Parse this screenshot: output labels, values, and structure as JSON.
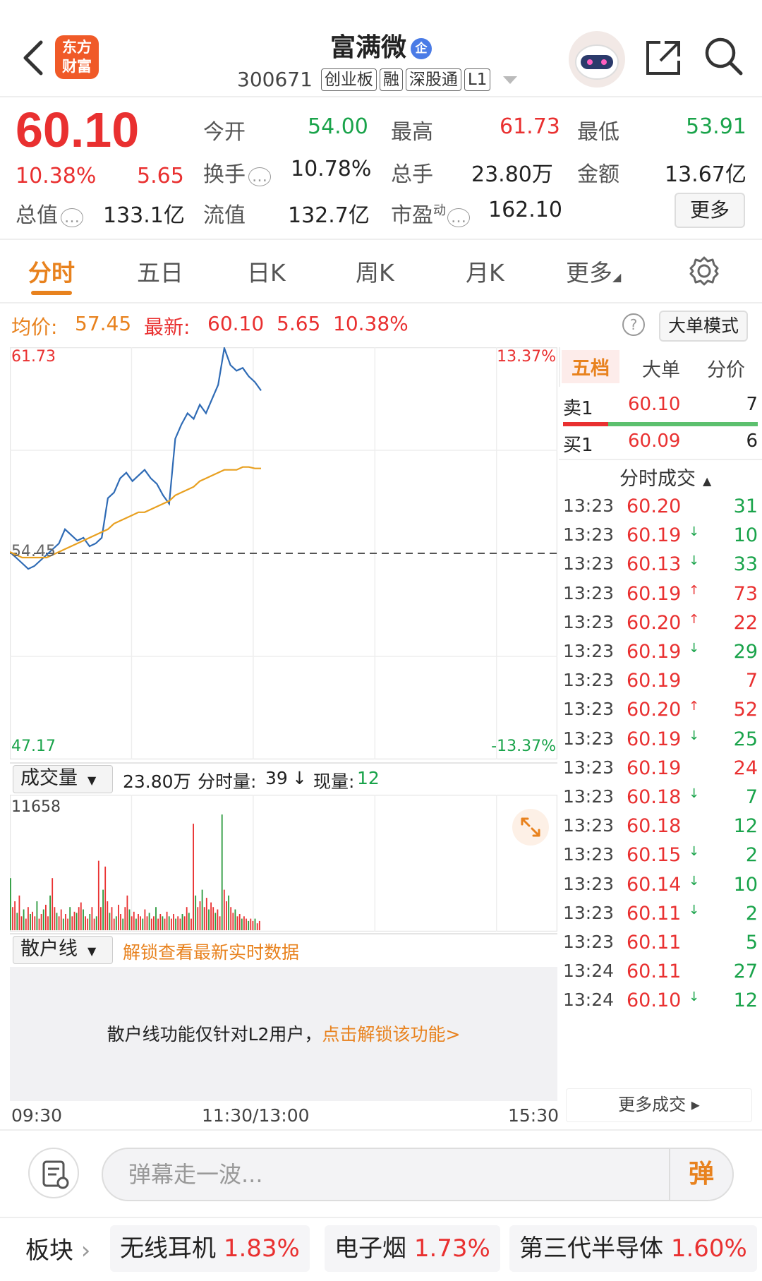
{
  "header": {
    "logo_text_1": "东方",
    "logo_text_2": "财富",
    "stock_name": "富满微",
    "badge": "企",
    "code": "300671",
    "tags": [
      "创业板",
      "融",
      "深股通",
      "L1"
    ]
  },
  "quote": {
    "price": "60.10",
    "change_pct": "10.38%",
    "change": "5.65",
    "items": [
      {
        "label": "今开",
        "value": "54.00"
      },
      {
        "label": "最高",
        "value": "61.73"
      },
      {
        "label": "最低",
        "value": "53.91"
      },
      {
        "label": "换手",
        "value": "10.78%"
      },
      {
        "label": "总手",
        "value": "23.80万"
      },
      {
        "label": "金额",
        "value": "13.67亿"
      },
      {
        "label": "总值",
        "value": "133.1亿"
      },
      {
        "label": "流值",
        "value": "132.7亿"
      },
      {
        "label": "市盈",
        "label_sup": "动",
        "value": "162.10"
      }
    ],
    "more_label": "更多"
  },
  "tabs": [
    "分时",
    "五日",
    "日K",
    "周K",
    "月K",
    "更多"
  ],
  "info_row": {
    "avg_label": "均价:",
    "avg_value": "57.45",
    "latest_label": "最新:",
    "latest_price": "60.10",
    "latest_change": "5.65",
    "latest_pct": "10.38%",
    "help_icon": "?",
    "mode_button": "大单模式"
  },
  "chart_data": {
    "type": "line",
    "y_max_label": "61.73",
    "y_min_label": "47.17",
    "y_mid_label": "54.45",
    "pct_max_label": "13.37%",
    "pct_min_label": "-13.37%",
    "ylim": [
      47.17,
      61.73
    ],
    "prev_close": 54.45,
    "x": [
      "09:30",
      "11:30/13:00",
      "15:30"
    ],
    "series": [
      {
        "color": "#2f6bb5",
        "values": [
          54.5,
          54.3,
          54.1,
          53.9,
          54.0,
          54.2,
          54.4,
          54.6,
          54.8,
          55.3,
          55.1,
          54.9,
          55.0,
          54.7,
          54.8,
          55.0,
          56.4,
          56.6,
          57.1,
          57.3,
          57.0,
          57.2,
          57.4,
          57.1,
          56.9,
          56.5,
          56.2,
          58.5,
          59.0,
          59.4,
          59.2,
          59.7,
          59.4,
          59.9,
          60.4,
          61.7,
          61.1,
          60.9,
          61.0,
          60.7,
          60.5,
          60.2
        ]
      },
      {
        "color": "#e8a020",
        "values": [
          54.5,
          54.4,
          54.3,
          54.3,
          54.3,
          54.3,
          54.3,
          54.4,
          54.5,
          54.6,
          54.7,
          54.8,
          54.9,
          55.0,
          55.1,
          55.2,
          55.3,
          55.5,
          55.6,
          55.7,
          55.8,
          55.9,
          55.9,
          56.0,
          56.1,
          56.2,
          56.3,
          56.5,
          56.6,
          56.7,
          56.8,
          57.0,
          57.1,
          57.2,
          57.3,
          57.4,
          57.4,
          57.4,
          57.5,
          57.5,
          57.45,
          57.45
        ]
      }
    ]
  },
  "volume": {
    "selector_label": "成交量",
    "total": "23.80万",
    "minute_label": "分时量:",
    "minute_value": "39",
    "minute_arrow": "↓",
    "now_label": "现量:",
    "now_value": "12",
    "max_label": "11658"
  },
  "retail": {
    "selector_label": "散户线",
    "unlock_hint": "解锁查看最新实时数据",
    "body_text": "散户线功能仅针对L2用户，",
    "body_link": "点击解锁该功能>"
  },
  "time_axis": [
    "09:30",
    "11:30/13:00",
    "15:30"
  ],
  "right_panel": {
    "tabs": [
      "五档",
      "大单",
      "分价"
    ],
    "sell1_label": "卖1",
    "sell1_price": "60.10",
    "sell1_vol": "7",
    "buy1_label": "买1",
    "buy1_price": "60.09",
    "buy1_vol": "6",
    "trades_title": "分时成交",
    "trades": [
      {
        "time": "13:23",
        "price": "60.20",
        "arrow": "",
        "vol": "31",
        "color": "#19a34a"
      },
      {
        "time": "13:23",
        "price": "60.19",
        "arrow": "↓",
        "vol": "10",
        "color": "#19a34a"
      },
      {
        "time": "13:23",
        "price": "60.13",
        "arrow": "↓",
        "vol": "33",
        "color": "#19a34a"
      },
      {
        "time": "13:23",
        "price": "60.19",
        "arrow": "↑",
        "vol": "73",
        "color": "#e93030"
      },
      {
        "time": "13:23",
        "price": "60.20",
        "arrow": "↑",
        "vol": "22",
        "color": "#e93030"
      },
      {
        "time": "13:23",
        "price": "60.19",
        "arrow": "↓",
        "vol": "29",
        "color": "#19a34a"
      },
      {
        "time": "13:23",
        "price": "60.19",
        "arrow": "",
        "vol": "7",
        "color": "#e93030"
      },
      {
        "time": "13:23",
        "price": "60.20",
        "arrow": "↑",
        "vol": "52",
        "color": "#e93030"
      },
      {
        "time": "13:23",
        "price": "60.19",
        "arrow": "↓",
        "vol": "25",
        "color": "#19a34a"
      },
      {
        "time": "13:23",
        "price": "60.19",
        "arrow": "",
        "vol": "24",
        "color": "#e93030"
      },
      {
        "time": "13:23",
        "price": "60.18",
        "arrow": "↓",
        "vol": "7",
        "color": "#19a34a"
      },
      {
        "time": "13:23",
        "price": "60.18",
        "arrow": "",
        "vol": "12",
        "color": "#19a34a"
      },
      {
        "time": "13:23",
        "price": "60.15",
        "arrow": "↓",
        "vol": "2",
        "color": "#19a34a"
      },
      {
        "time": "13:23",
        "price": "60.14",
        "arrow": "↓",
        "vol": "10",
        "color": "#19a34a"
      },
      {
        "time": "13:23",
        "price": "60.11",
        "arrow": "↓",
        "vol": "2",
        "color": "#19a34a"
      },
      {
        "time": "13:23",
        "price": "60.11",
        "arrow": "",
        "vol": "5",
        "color": "#19a34a"
      },
      {
        "time": "13:24",
        "price": "60.11",
        "arrow": "",
        "vol": "27",
        "color": "#19a34a"
      },
      {
        "time": "13:24",
        "price": "60.10",
        "arrow": "↓",
        "vol": "12",
        "color": "#19a34a"
      }
    ],
    "more_trades": "更多成交 ▸"
  },
  "comment": {
    "placeholder": "弹幕走一波...",
    "danmu_label": "弹"
  },
  "sectors": {
    "label": "板块",
    "items": [
      {
        "name": "无线耳机",
        "pct": "1.83%"
      },
      {
        "name": "电子烟",
        "pct": "1.73%"
      },
      {
        "name": "第三代半导体",
        "pct": "1.60%"
      }
    ]
  }
}
